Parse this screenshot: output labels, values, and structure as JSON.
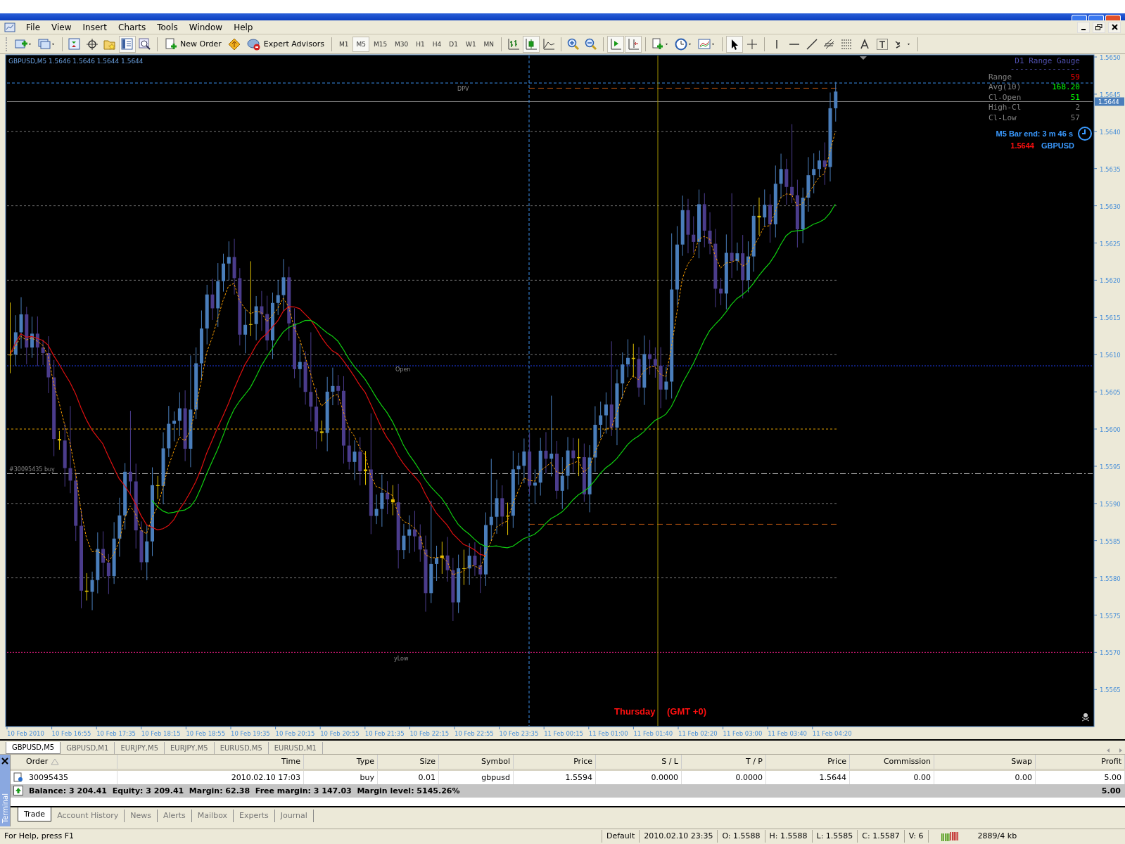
{
  "menu": [
    "File",
    "View",
    "Insert",
    "Charts",
    "Tools",
    "Window",
    "Help"
  ],
  "toolbar": {
    "new_order": "New Order",
    "expert_advisors": "Expert Advisors",
    "timeframes": [
      {
        "label": "M1",
        "selected": false
      },
      {
        "label": "M5",
        "selected": true
      },
      {
        "label": "M15",
        "selected": false
      },
      {
        "label": "M30",
        "selected": false
      },
      {
        "label": "H1",
        "selected": false
      },
      {
        "label": "H4",
        "selected": false
      },
      {
        "label": "D1",
        "selected": false
      },
      {
        "label": "W1",
        "selected": false
      },
      {
        "label": "MN",
        "selected": false
      }
    ]
  },
  "chart": {
    "header": "GBPUSD,M5  1.5646 1.5646 1.5644 1.5644",
    "price_labels": [
      "1.5650",
      "1.5645",
      "1.5640",
      "1.5635",
      "1.5630",
      "1.5625",
      "1.5620",
      "1.5615",
      "1.5610",
      "1.5605",
      "1.5600",
      "1.5595",
      "1.5590",
      "1.5585",
      "1.5580",
      "1.5575",
      "1.5570",
      "1.5565"
    ],
    "current_price": "1.5644",
    "time_labels": [
      "10 Feb 2010",
      "10 Feb 16:55",
      "10 Feb 17:35",
      "10 Feb 18:15",
      "10 Feb 18:55",
      "10 Feb 19:35",
      "10 Feb 20:15",
      "10 Feb 20:55",
      "10 Feb 21:35",
      "10 Feb 22:15",
      "10 Feb 22:55",
      "10 Feb 23:35",
      "11 Feb 00:15",
      "11 Feb 01:00",
      "11 Feb 01:40",
      "11 Feb 02:20",
      "11 Feb 03:00",
      "11 Feb 03:40",
      "11 Feb 04:20"
    ],
    "level_labels": {
      "dpv": "DPV",
      "open": "Open",
      "ylow": "yLow",
      "order": "#30095435 buy"
    },
    "day_label": "Thursday",
    "timezone_label": "(GMT +0)",
    "gauge": {
      "title": "D1 Range Gauge",
      "divider": "---------------",
      "rows": [
        {
          "label": "Range",
          "value": "59",
          "color": "#ff0000"
        },
        {
          "label": "Avg(10)",
          "value": "168.20",
          "color": "#00ff00"
        },
        {
          "label": "Cl-Open",
          "value": "51",
          "color": "#00ff00"
        },
        {
          "label": "High-Cl",
          "value": "2",
          "color": "#808080"
        },
        {
          "label": "Cl-Low",
          "value": "57",
          "color": "#808080"
        }
      ],
      "bar_end": "M5 Bar end: 3 m 46 s",
      "price": "1.5644",
      "symbol": "GBPUSD"
    }
  },
  "chart_tabs": [
    {
      "label": "GBPUSD,M5",
      "selected": true
    },
    {
      "label": "GBPUSD,M1",
      "selected": false
    },
    {
      "label": "EURJPY,M5",
      "selected": false
    },
    {
      "label": "EURJPY,M5",
      "selected": false
    },
    {
      "label": "EURUSD,M5",
      "selected": false
    },
    {
      "label": "EURUSD,M1",
      "selected": false
    }
  ],
  "terminal": {
    "label": "Terminal",
    "columns": [
      "Order",
      "Time",
      "Type",
      "Size",
      "Symbol",
      "Price",
      "S / L",
      "T / P",
      "Price",
      "Commission",
      "Swap",
      "Profit"
    ],
    "rows": [
      {
        "cells": [
          "30095435",
          "2010.02.10 17:03",
          "buy",
          "0.01",
          "gbpusd",
          "1.5594",
          "0.0000",
          "0.0000",
          "1.5644",
          "0.00",
          "0.00",
          "5.00"
        ]
      }
    ],
    "summary": "Balance: 3 204.41  Equity: 3 209.41  Margin: 62.38  Free margin: 3 147.03  Margin level: 5145.26%",
    "total": "5.00",
    "tabs": [
      {
        "label": "Trade",
        "selected": true
      },
      {
        "label": "Account History",
        "selected": false
      },
      {
        "label": "News",
        "selected": false
      },
      {
        "label": "Alerts",
        "selected": false
      },
      {
        "label": "Mailbox",
        "selected": false
      },
      {
        "label": "Experts",
        "selected": false
      },
      {
        "label": "Journal",
        "selected": false
      }
    ]
  },
  "status_bar": {
    "help": "For Help, press F1",
    "fields": [
      "Default",
      "2010.02.10 23:35",
      "O: 1.5588",
      "H: 1.5588",
      "L: 1.5585",
      "C: 1.5587",
      "V: 6"
    ],
    "traffic": "2889/4 kb"
  }
}
